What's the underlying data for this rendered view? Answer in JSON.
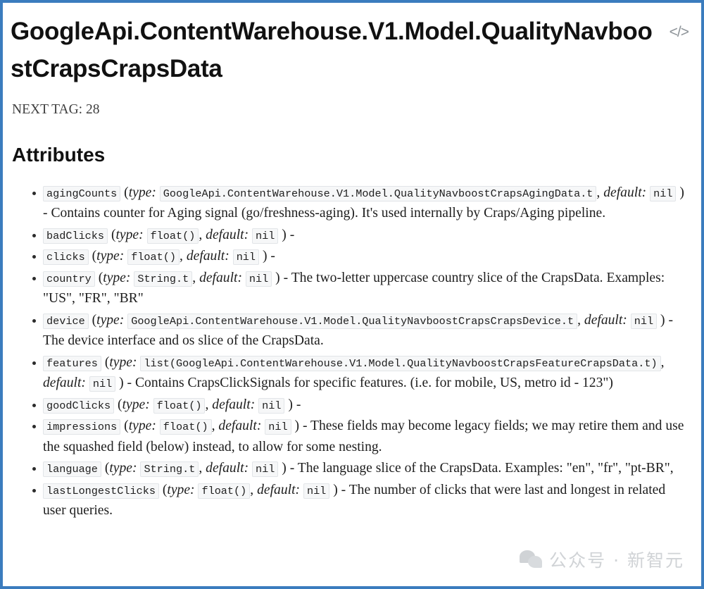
{
  "document": {
    "title": "GoogleApi.ContentWarehouse.V1.Model.QualityNavboostCrapsCrapsData",
    "next_tag": "NEXT TAG: 28",
    "code_icon": "</>",
    "section_heading": "Attributes"
  },
  "labels": {
    "type_label": "type:",
    "default_label": "default:",
    "open_paren": "(",
    "close_paren": ")",
    "comma": ",",
    "dash": "-"
  },
  "attributes": [
    {
      "name": "agingCounts",
      "type": "GoogleApi.ContentWarehouse.V1.Model.QualityNavboostCrapsAgingData.t",
      "default": "nil",
      "description": "Contains counter for Aging signal (go/freshness-aging). It's used internally by Craps/Aging pipeline."
    },
    {
      "name": "badClicks",
      "type": "float()",
      "default": "nil",
      "description": ""
    },
    {
      "name": "clicks",
      "type": "float()",
      "default": "nil",
      "description": ""
    },
    {
      "name": "country",
      "type": "String.t",
      "default": "nil",
      "description": "The two-letter uppercase country slice of the CrapsData. Examples: \"US\", \"FR\", \"BR\""
    },
    {
      "name": "device",
      "type": "GoogleApi.ContentWarehouse.V1.Model.QualityNavboostCrapsCrapsDevice.t",
      "default": "nil",
      "description": "The device interface and os slice of the CrapsData."
    },
    {
      "name": "features",
      "type": "list(GoogleApi.ContentWarehouse.V1.Model.QualityNavboostCrapsFeatureCrapsData.t)",
      "default": "nil",
      "description": "Contains CrapsClickSignals for specific features. (i.e. for mobile, US, metro id - 123\")"
    },
    {
      "name": "goodClicks",
      "type": "float()",
      "default": "nil",
      "description": ""
    },
    {
      "name": "impressions",
      "type": "float()",
      "default": "nil",
      "description": "These fields may become legacy fields; we may retire them and use the squashed field (below) instead, to allow for some nesting."
    },
    {
      "name": "language",
      "type": "String.t",
      "default": "nil",
      "description": "The language slice of the CrapsData. Examples: \"en\", \"fr\", \"pt-BR\","
    },
    {
      "name": "lastLongestClicks",
      "type": "float()",
      "default": "nil",
      "description": "The number of clicks that were last and longest in related user queries."
    }
  ],
  "watermark": {
    "text": "公众号 · 新智元"
  },
  "colors": {
    "frame_border": "#3b7cbe",
    "code_background": "#f6f7f8",
    "code_border": "#e2e5e8",
    "text": "#1d1d1d",
    "watermark": "#d0d3d6"
  }
}
